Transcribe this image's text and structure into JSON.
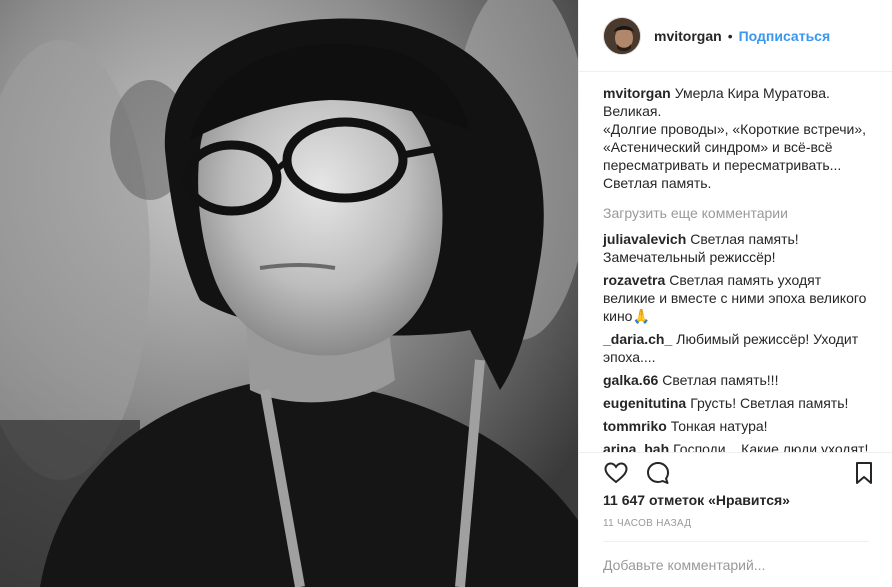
{
  "post": {
    "author": "mvitorgan",
    "follow_label": "Подписаться",
    "separator": "•",
    "caption_user": "mvitorgan",
    "caption_lines": [
      "Умерла Кира Муратова.",
      "Великая.",
      "«Долгие проводы», «Короткие встречи»,",
      "«Астенический синдром» и всё-всё",
      "пересматривать и пересматривать...",
      "Светлая память."
    ],
    "load_more": "Загрузить еще комментарии",
    "comments": [
      {
        "user": "juliavalevich",
        "text": "Светлая память! Замечательный режиссёр!"
      },
      {
        "user": "rozavetra",
        "text": "Светлая память уходят великие и вместе с ними эпоха великого кино🙏"
      },
      {
        "user": "_daria.ch_",
        "text": "Любимый режиссёр! Уходит эпоха...."
      },
      {
        "user": "galka.66",
        "text": "Светлая память!!!"
      },
      {
        "user": "eugenitutina",
        "text": "Грусть! Светлая память!"
      },
      {
        "user": "tommriko",
        "text": "Тонкая натура!"
      },
      {
        "user": "arina_bah",
        "text": "Господи... Какие люди уходят!"
      }
    ],
    "likes": "11 647 отметок «Нравится»",
    "time": "11 часов назад",
    "add_comment_placeholder": "Добавьте комментарий..."
  },
  "icons": {
    "like": "heart-icon",
    "comment": "comment-icon",
    "save": "bookmark-icon"
  },
  "colors": {
    "link": "#3897f0",
    "text": "#262626",
    "muted": "#999999",
    "border": "#efefef"
  }
}
